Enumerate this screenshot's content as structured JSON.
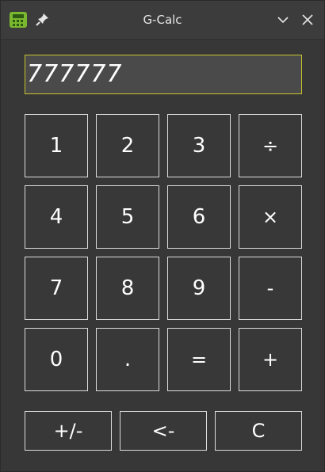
{
  "window": {
    "title": "G-Calc",
    "app_icon": "calculator-box-icon",
    "pin_icon": "pin-icon",
    "minimize_icon": "chevron-down-icon",
    "close_icon": "close-icon"
  },
  "display": {
    "value": "777777"
  },
  "keypad": {
    "rows": [
      [
        "1",
        "2",
        "3",
        "÷"
      ],
      [
        "4",
        "5",
        "6",
        "×"
      ],
      [
        "7",
        "8",
        "9",
        "-"
      ],
      [
        "0",
        ".",
        "=",
        "+"
      ]
    ],
    "bottom": [
      "+/-",
      "<-",
      "C"
    ]
  },
  "colors": {
    "window_bg": "#373737",
    "display_bg": "#4a4a4a",
    "display_border": "#c8c42a",
    "key_border": "#dcdcdc",
    "text": "#ffffff"
  }
}
